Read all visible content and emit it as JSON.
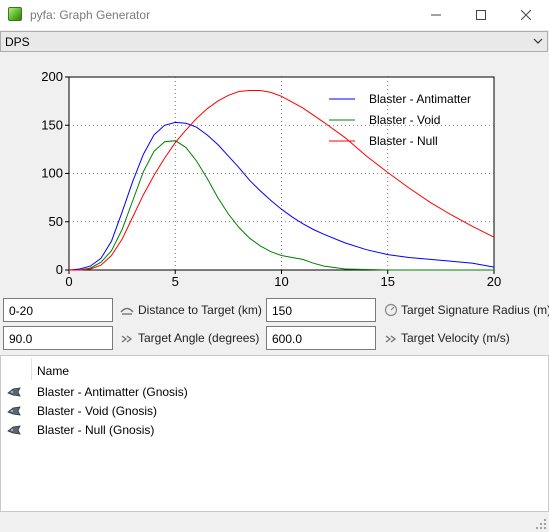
{
  "window": {
    "title": "pyfa: Graph Generator",
    "minimize_glyph": "—",
    "maximize_glyph": "☐",
    "close_glyph": "✕"
  },
  "graph_selector": {
    "value": "DPS"
  },
  "chart_data": {
    "type": "line",
    "xlim": [
      0,
      20
    ],
    "ylim": [
      0,
      200
    ],
    "xticks": [
      "0",
      "5",
      "10",
      "15",
      "20"
    ],
    "yticks": [
      "0",
      "50",
      "100",
      "150",
      "200"
    ],
    "grid": true,
    "legend_position": "top-right",
    "series": [
      {
        "name": "Blaster - Antimatter",
        "color": "#0000ff",
        "x": [
          0,
          0.5,
          1,
          1.5,
          2,
          2.5,
          3,
          3.5,
          4,
          4.5,
          5,
          5.5,
          6,
          6.5,
          7,
          7.5,
          8,
          8.5,
          9,
          9.5,
          10,
          10.5,
          11,
          11.5,
          12,
          13,
          14,
          15,
          16,
          17,
          18,
          19,
          20
        ],
        "y": [
          0,
          1,
          4,
          12,
          30,
          60,
          92,
          120,
          140,
          150,
          153,
          152,
          148,
          140,
          130,
          118,
          106,
          93,
          82,
          72,
          63,
          55,
          48,
          42,
          37,
          28,
          21,
          16,
          13,
          11,
          9,
          7,
          3
        ]
      },
      {
        "name": "Blaster - Void",
        "color": "#008000",
        "x": [
          0,
          0.5,
          1,
          1.5,
          2,
          2.5,
          3,
          3.5,
          4,
          4.5,
          5,
          5.5,
          6,
          6.5,
          7,
          7.5,
          8,
          8.5,
          9,
          9.5,
          10,
          10.5,
          11,
          11.5,
          12,
          13,
          14,
          15,
          16,
          17,
          18,
          19,
          20
        ],
        "y": [
          0,
          0,
          2,
          8,
          20,
          42,
          72,
          102,
          123,
          133,
          134,
          127,
          113,
          95,
          75,
          58,
          44,
          33,
          25,
          19,
          15,
          13,
          11,
          7,
          4,
          1,
          0.5,
          0,
          0,
          0,
          0,
          0,
          0
        ]
      },
      {
        "name": "Blaster - Null",
        "color": "#ff0000",
        "x": [
          0,
          0.5,
          1,
          1.5,
          2,
          2.5,
          3,
          3.5,
          4,
          4.5,
          5,
          5.5,
          6,
          6.5,
          7,
          7.5,
          8,
          8.5,
          9,
          9.5,
          10,
          11,
          12,
          13,
          14,
          15,
          16,
          17,
          18,
          19,
          20
        ],
        "y": [
          0,
          0,
          1,
          5,
          15,
          32,
          55,
          78,
          98,
          116,
          132,
          145,
          157,
          167,
          175,
          181,
          185,
          186,
          186,
          184,
          180,
          168,
          153,
          137,
          118,
          101,
          85,
          70,
          57,
          45,
          34
        ]
      }
    ]
  },
  "controls": {
    "distance": {
      "value": "0-20",
      "label": "Distance to Target (km)"
    },
    "signature": {
      "value": "150",
      "label": "Target Signature Radius (m)"
    },
    "angle": {
      "value": "90.0",
      "label": "Target Angle (degrees)"
    },
    "velocity": {
      "value": "600.0",
      "label": "Target Velocity (m/s)"
    }
  },
  "fit_list": {
    "column_header": "Name",
    "items": [
      {
        "label": "Blaster - Antimatter (Gnosis)",
        "icon": "ship-icon"
      },
      {
        "label": "Blaster - Void (Gnosis)",
        "icon": "ship-icon"
      },
      {
        "label": "Blaster - Null (Gnosis)",
        "icon": "ship-icon"
      }
    ]
  }
}
